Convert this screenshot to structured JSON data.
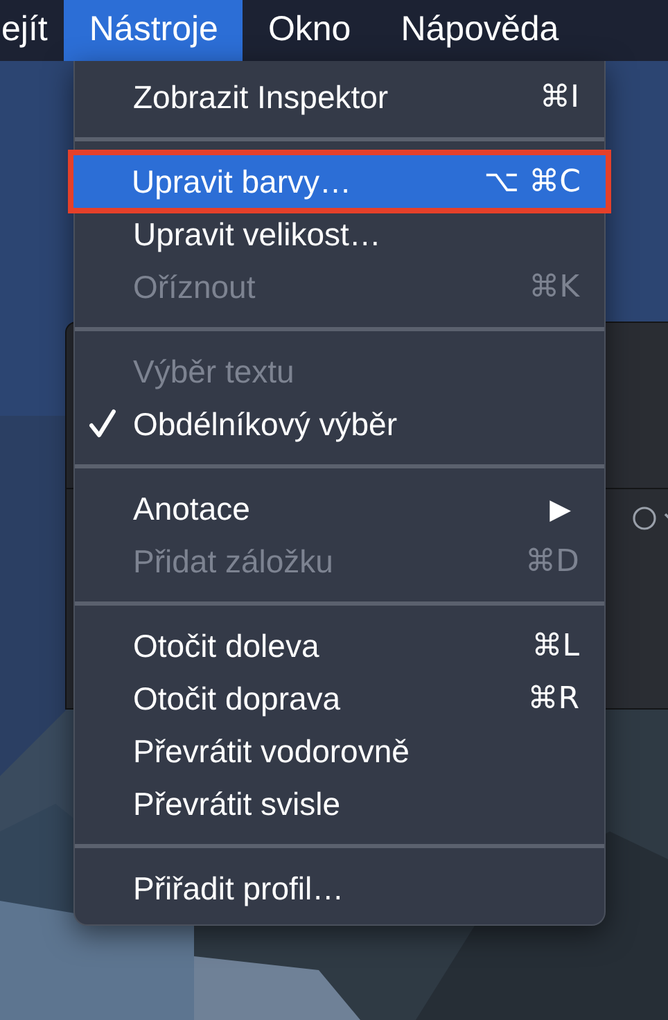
{
  "menubar": {
    "items": [
      {
        "label": "ejít",
        "selected": false
      },
      {
        "label": "Nástroje",
        "selected": true
      },
      {
        "label": "Okno",
        "selected": false
      },
      {
        "label": "Nápověda",
        "selected": false
      }
    ]
  },
  "menu": {
    "groups": [
      [
        {
          "label": "Zobrazit Inspektor",
          "shortcut": "⌘I",
          "disabled": false,
          "checked": false,
          "selected": false,
          "outlined": false
        }
      ],
      [
        {
          "label": "Upravit barvy…",
          "shortcut": "⌥ ⌘C",
          "disabled": false,
          "checked": false,
          "selected": true,
          "outlined": true
        },
        {
          "label": "Upravit velikost…",
          "disabled": false,
          "checked": false,
          "selected": false,
          "outlined": false
        },
        {
          "label": "Oříznout",
          "shortcut": "⌘K",
          "disabled": true,
          "checked": false,
          "selected": false,
          "outlined": false
        }
      ],
      [
        {
          "label": "Výběr textu",
          "disabled": true,
          "checked": false,
          "selected": false,
          "outlined": false
        },
        {
          "label": "Obdélníkový výběr",
          "disabled": false,
          "checked": true,
          "selected": false,
          "outlined": false
        }
      ],
      [
        {
          "label": "Anotace",
          "submenu_arrow": "▶",
          "disabled": false,
          "checked": false,
          "selected": false,
          "outlined": false
        },
        {
          "label": "Přidat záložku",
          "shortcut": "⌘D",
          "disabled": true,
          "checked": false,
          "selected": false,
          "outlined": false
        }
      ],
      [
        {
          "label": "Otočit doleva",
          "shortcut": "⌘L",
          "disabled": false,
          "checked": false,
          "selected": false,
          "outlined": false
        },
        {
          "label": "Otočit doprava",
          "shortcut": "⌘R",
          "disabled": false,
          "checked": false,
          "selected": false,
          "outlined": false
        },
        {
          "label": "Převrátit vodorovně",
          "disabled": false,
          "checked": false,
          "selected": false,
          "outlined": false
        },
        {
          "label": "Převrátit svisle",
          "disabled": false,
          "checked": false,
          "selected": false,
          "outlined": false
        }
      ],
      [
        {
          "label": "Přiřadit profil…",
          "disabled": false,
          "checked": false,
          "selected": false,
          "outlined": false
        }
      ]
    ]
  }
}
